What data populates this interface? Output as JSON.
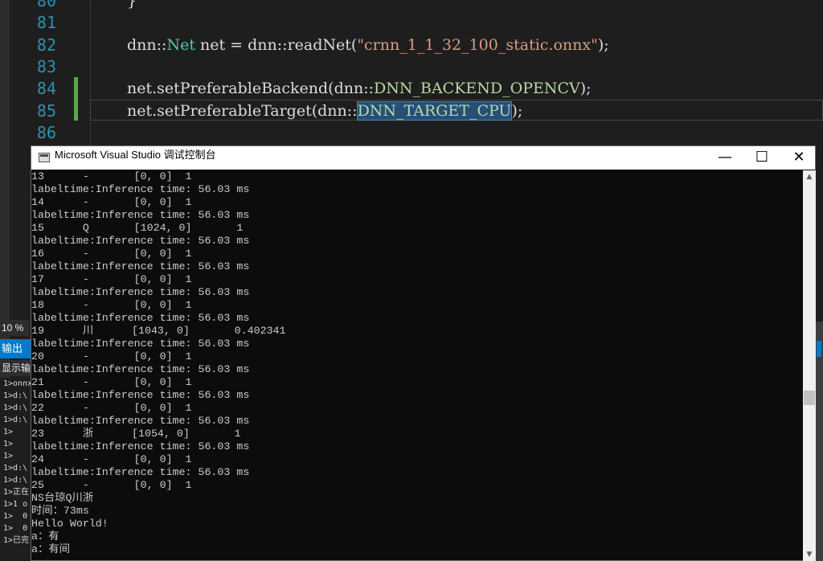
{
  "editor": {
    "lines": [
      {
        "num": "80",
        "segments": [
          {
            "text": "}",
            "cls": ""
          }
        ]
      },
      {
        "num": "81",
        "segments": []
      },
      {
        "num": "82",
        "segments": [
          {
            "text": "dnn::",
            "cls": ""
          },
          {
            "text": "Net",
            "cls": "kw-ns"
          },
          {
            "text": " net = dnn::readNet(",
            "cls": ""
          },
          {
            "text": "\"crnn_1_1_32_100_static.onnx\"",
            "cls": "str"
          },
          {
            "text": ");",
            "cls": ""
          }
        ]
      },
      {
        "num": "83",
        "segments": []
      },
      {
        "num": "84",
        "segments": [
          {
            "text": "net.setPreferableBackend(dnn::",
            "cls": ""
          },
          {
            "text": "DNN_BACKEND_OPENCV",
            "cls": "enum"
          },
          {
            "text": ");",
            "cls": ""
          }
        ]
      },
      {
        "num": "85",
        "segments": [
          {
            "text": "net.setPreferableTarget(dnn::",
            "cls": ""
          },
          {
            "text": "DNN_TARGET_CPU",
            "cls": "enum sel"
          },
          {
            "text": ");",
            "cls": ""
          }
        ]
      },
      {
        "num": "86",
        "segments": []
      }
    ]
  },
  "output_pane": {
    "zoom": "10 %",
    "title": "输出",
    "show_label": "显示输",
    "lines": [
      "1>onnx",
      "1>d:\\",
      "1>d:\\",
      "1>d:\\",
      "1>",
      "1>",
      "1>",
      "1>d:\\",
      "1>d:\\",
      "1>正在",
      "1>1 o",
      "1>  0",
      "1>  0",
      "1>已完"
    ]
  },
  "console": {
    "title": "Microsoft Visual Studio 调试控制台",
    "buttons": {
      "minimize": "—",
      "maximize": "☐",
      "close": "✕"
    },
    "lines": [
      "13      -       [0, 0]  1",
      "labeltime:Inference time: 56.03 ms",
      "14      -       [0, 0]  1",
      "labeltime:Inference time: 56.03 ms",
      "15      Q       [1024, 0]       1",
      "labeltime:Inference time: 56.03 ms",
      "16      -       [0, 0]  1",
      "labeltime:Inference time: 56.03 ms",
      "17      -       [0, 0]  1",
      "labeltime:Inference time: 56.03 ms",
      "18      -       [0, 0]  1",
      "labeltime:Inference time: 56.03 ms",
      "19      川      [1043, 0]       0.402341",
      "labeltime:Inference time: 56.03 ms",
      "20      -       [0, 0]  1",
      "labeltime:Inference time: 56.03 ms",
      "21      -       [0, 0]  1",
      "labeltime:Inference time: 56.03 ms",
      "22      -       [0, 0]  1",
      "labeltime:Inference time: 56.03 ms",
      "23      浙      [1054, 0]       1",
      "labeltime:Inference time: 56.03 ms",
      "24      -       [0, 0]  1",
      "labeltime:Inference time: 56.03 ms",
      "25      -       [0, 0]  1",
      "NS台琼Q川浙",
      "时间：73ms",
      "Hello World!",
      "a：有",
      "a：有间"
    ]
  },
  "colors": {
    "editor_bg": "#1e1e1e",
    "console_bg": "#0c0c0c",
    "accent": "#007acc",
    "line_number": "#2b91af",
    "enum": "#b8d7a3",
    "string": "#d69d85",
    "type": "#4ec9b0"
  }
}
